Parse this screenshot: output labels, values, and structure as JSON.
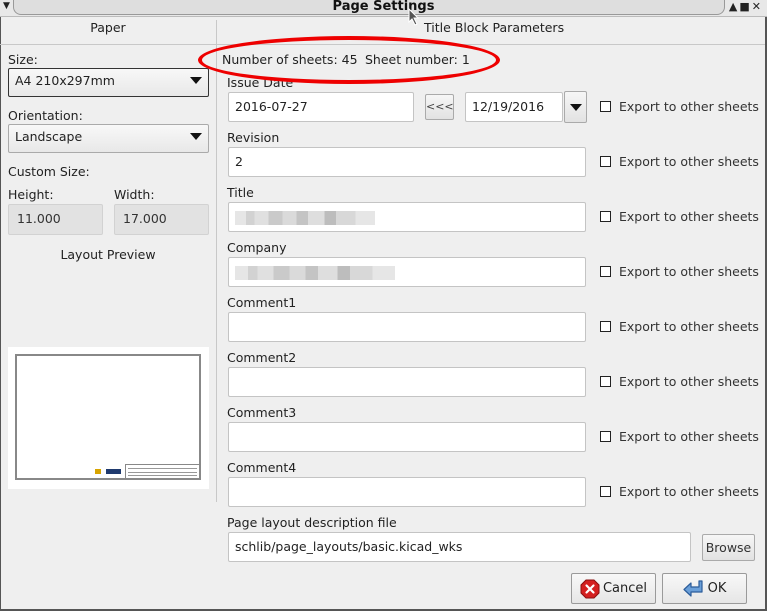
{
  "window": {
    "title": "Page Settings",
    "menu_icon": "chevron-down-icon",
    "controls": [
      "minimize-icon",
      "maximize-icon",
      "close-icon"
    ],
    "controls_glyphs": "▲■✕"
  },
  "paper": {
    "header": "Paper",
    "size_label": "Size:",
    "size_value": "A4 210x297mm",
    "orientation_label": "Orientation:",
    "orientation_value": "Landscape",
    "custom_size_label": "Custom Size:",
    "height_label": "Height:",
    "height_value": "11.000",
    "width_label": "Width:",
    "width_value": "17.000",
    "preview_label": "Layout Preview"
  },
  "title_block": {
    "header": "Title Block Parameters",
    "number_of_sheets_label": "Number of sheets: 45",
    "sheet_number_label": "Sheet number: 1",
    "export_label": "Export to other sheets",
    "issue_date": {
      "label": "Issue Date",
      "value": "2016-07-27",
      "copy_button": "<<<",
      "picker_value": "12/19/2016",
      "export_checked": false
    },
    "fields": [
      {
        "label": "Revision",
        "value": "2",
        "redacted": false,
        "export_checked": false
      },
      {
        "label": "Title",
        "value": "",
        "redacted": true,
        "export_checked": false
      },
      {
        "label": "Company",
        "value": "",
        "redacted": true,
        "export_checked": false
      },
      {
        "label": "Comment1",
        "value": "",
        "redacted": false,
        "export_checked": false
      },
      {
        "label": "Comment2",
        "value": "",
        "redacted": false,
        "export_checked": false
      },
      {
        "label": "Comment3",
        "value": "",
        "redacted": false,
        "export_checked": false
      },
      {
        "label": "Comment4",
        "value": "",
        "redacted": false,
        "export_checked": false
      }
    ],
    "layout_file_label": "Page layout description file",
    "layout_file_value": "schlib/page_layouts/basic.kicad_wks",
    "browse_button": "Browse"
  },
  "buttons": {
    "cancel": "Cancel",
    "ok": "OK"
  },
  "annotation": {
    "color": "#ee0000"
  }
}
